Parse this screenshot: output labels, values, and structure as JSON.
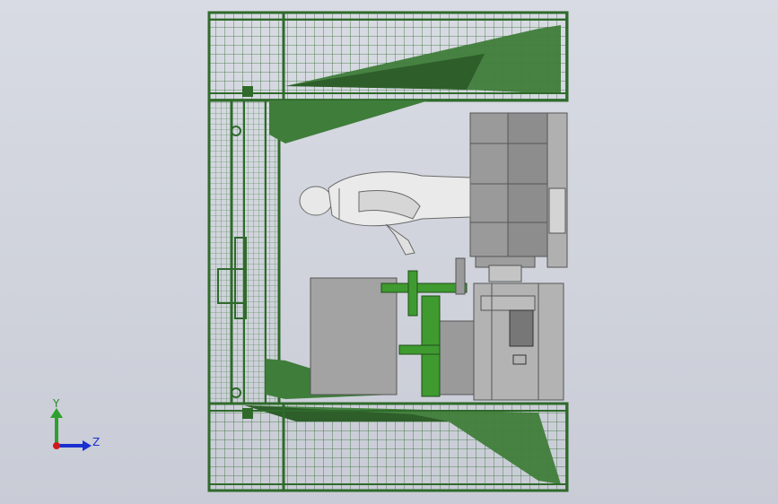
{
  "viewport": {
    "background_color": "#cdd0d9",
    "frame_color": "#2f6a2b",
    "panel_fill_color": "#3f7d3a",
    "machine_color": "#9a9a9a",
    "figure_color": "#e8e8e8"
  },
  "triad": {
    "y_label": "Y",
    "z_label": "Z",
    "y_axis_color": "#2fa02f",
    "z_axis_color": "#1a2fd0",
    "x_axis_color": "#d01a1a"
  }
}
